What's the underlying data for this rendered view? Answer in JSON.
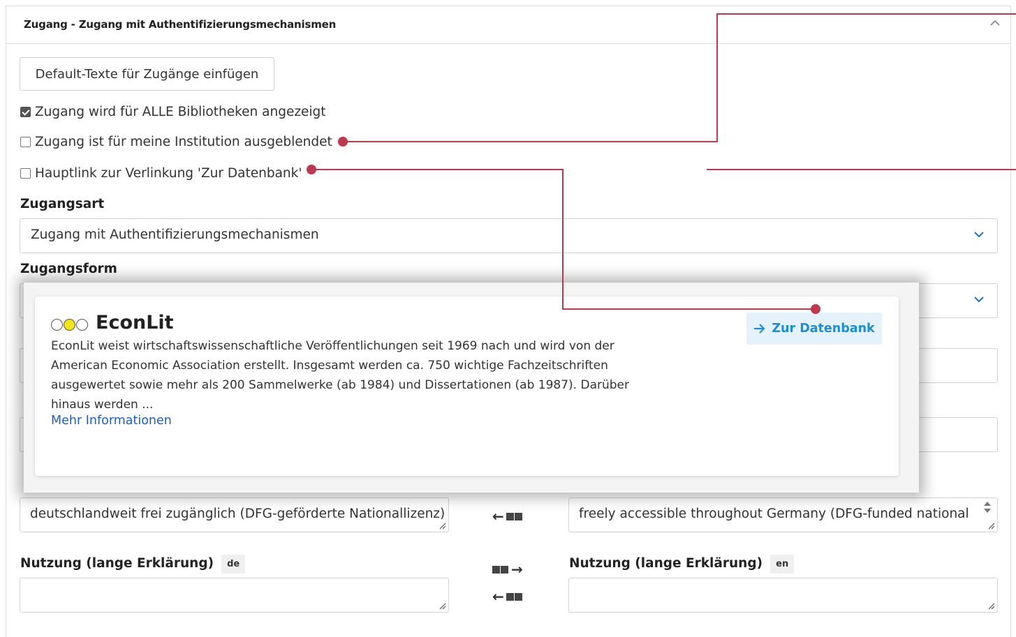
{
  "panel": {
    "title": "Zugang - Zugang mit Authentifizierungsmechanismen"
  },
  "buttons": {
    "default_texts": "Default-Texte für Zugänge einfügen"
  },
  "checkboxes": [
    {
      "label": "Zugang wird für ALLE Bibliotheken angezeigt",
      "checked": true
    },
    {
      "label": "Zugang ist für meine Institution ausgeblendet",
      "checked": false
    },
    {
      "label": "Hauptlink zur Verlinkung 'Zur Datenbank'",
      "checked": false
    }
  ],
  "fields": {
    "zugangsart_label": "Zugangsart",
    "zugangsart_value": "Zugang mit Authentifizierungsmechanismen",
    "zugangsform_label": "Zugangsform",
    "usage_short_de": "deutschlandweit frei zugänglich (DFG-geförderte Nationallizenz)",
    "usage_short_en": "freely accessible throughout Germany (DFG-funded national",
    "usage_long_de_label": "Nutzung (lange Erklärung)",
    "usage_long_de_lang": "de",
    "usage_long_en_label": "Nutzung (lange Erklärung)",
    "usage_long_en_lang": "en"
  },
  "preview": {
    "title": "EconLit",
    "description": "EconLit weist wirtschaftswissenschaftliche Veröffentlichungen seit 1969 nach und wird von der American Economic Association erstellt. Insgesamt werden ca. 750 wichtige Fachzeitschriften ausgewertet sowie mehr als 200 Sammelwerke (ab 1984) und Dissertationen (ab 1987). Darüber hinaus werden ...",
    "more_link": "Mehr Informationen",
    "db_button": "Zur Datenbank"
  },
  "colors": {
    "annotation": "#c0384e",
    "link": "#1a5fc8",
    "db_button_text": "#1a8fd6",
    "db_button_bg": "#e5f1fb",
    "traffic_light_active": "#f2e41a"
  },
  "icons": {
    "collapse": "chevron-up-icon",
    "dropdown": "chevron-down-icon",
    "translate_to_en": "translate-right-icon",
    "translate_to_de": "translate-left-icon",
    "db_arrow": "arrow-right-icon"
  }
}
